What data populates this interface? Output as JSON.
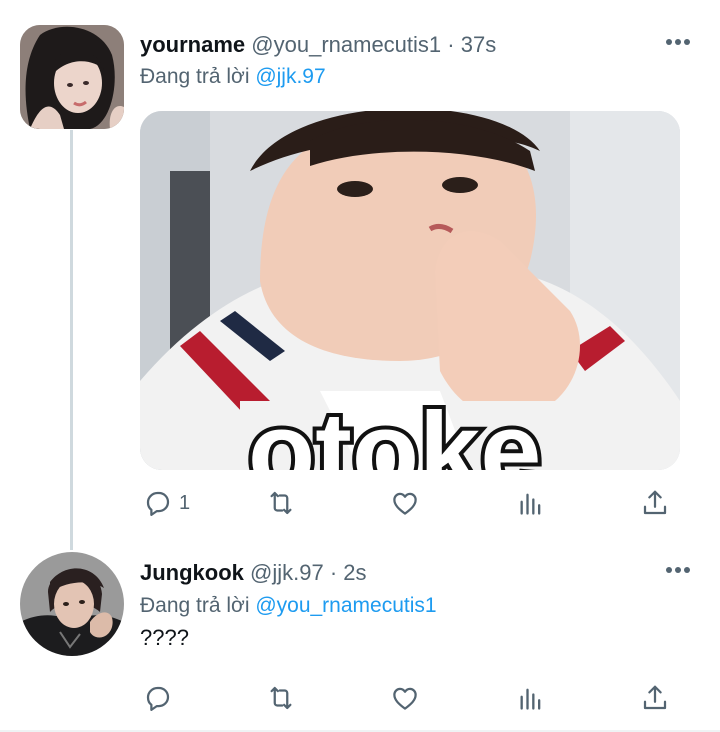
{
  "tweets": [
    {
      "display_name": "yourname",
      "handle": "@you_rnamecutis1",
      "time": "· 37s",
      "reply_prefix": "Đang trả lời",
      "reply_to": "@jjk.97",
      "media_caption": "otoke",
      "actions": {
        "reply_count": "1"
      }
    },
    {
      "display_name": "Jungkook",
      "handle": "@jjk.97",
      "time": "· 2s",
      "reply_prefix": "Đang trả lời",
      "reply_to": "@you_rnamecutis1",
      "text": "????",
      "actions": {
        "reply_count": ""
      }
    }
  ],
  "icons": [
    "more-icon",
    "reply-icon",
    "retweet-icon",
    "like-icon",
    "analytics-icon",
    "share-icon"
  ],
  "colors": {
    "link": "#1d9bf0",
    "muted": "#536471",
    "text": "#0f1419",
    "thread_line": "#cfd9de"
  }
}
